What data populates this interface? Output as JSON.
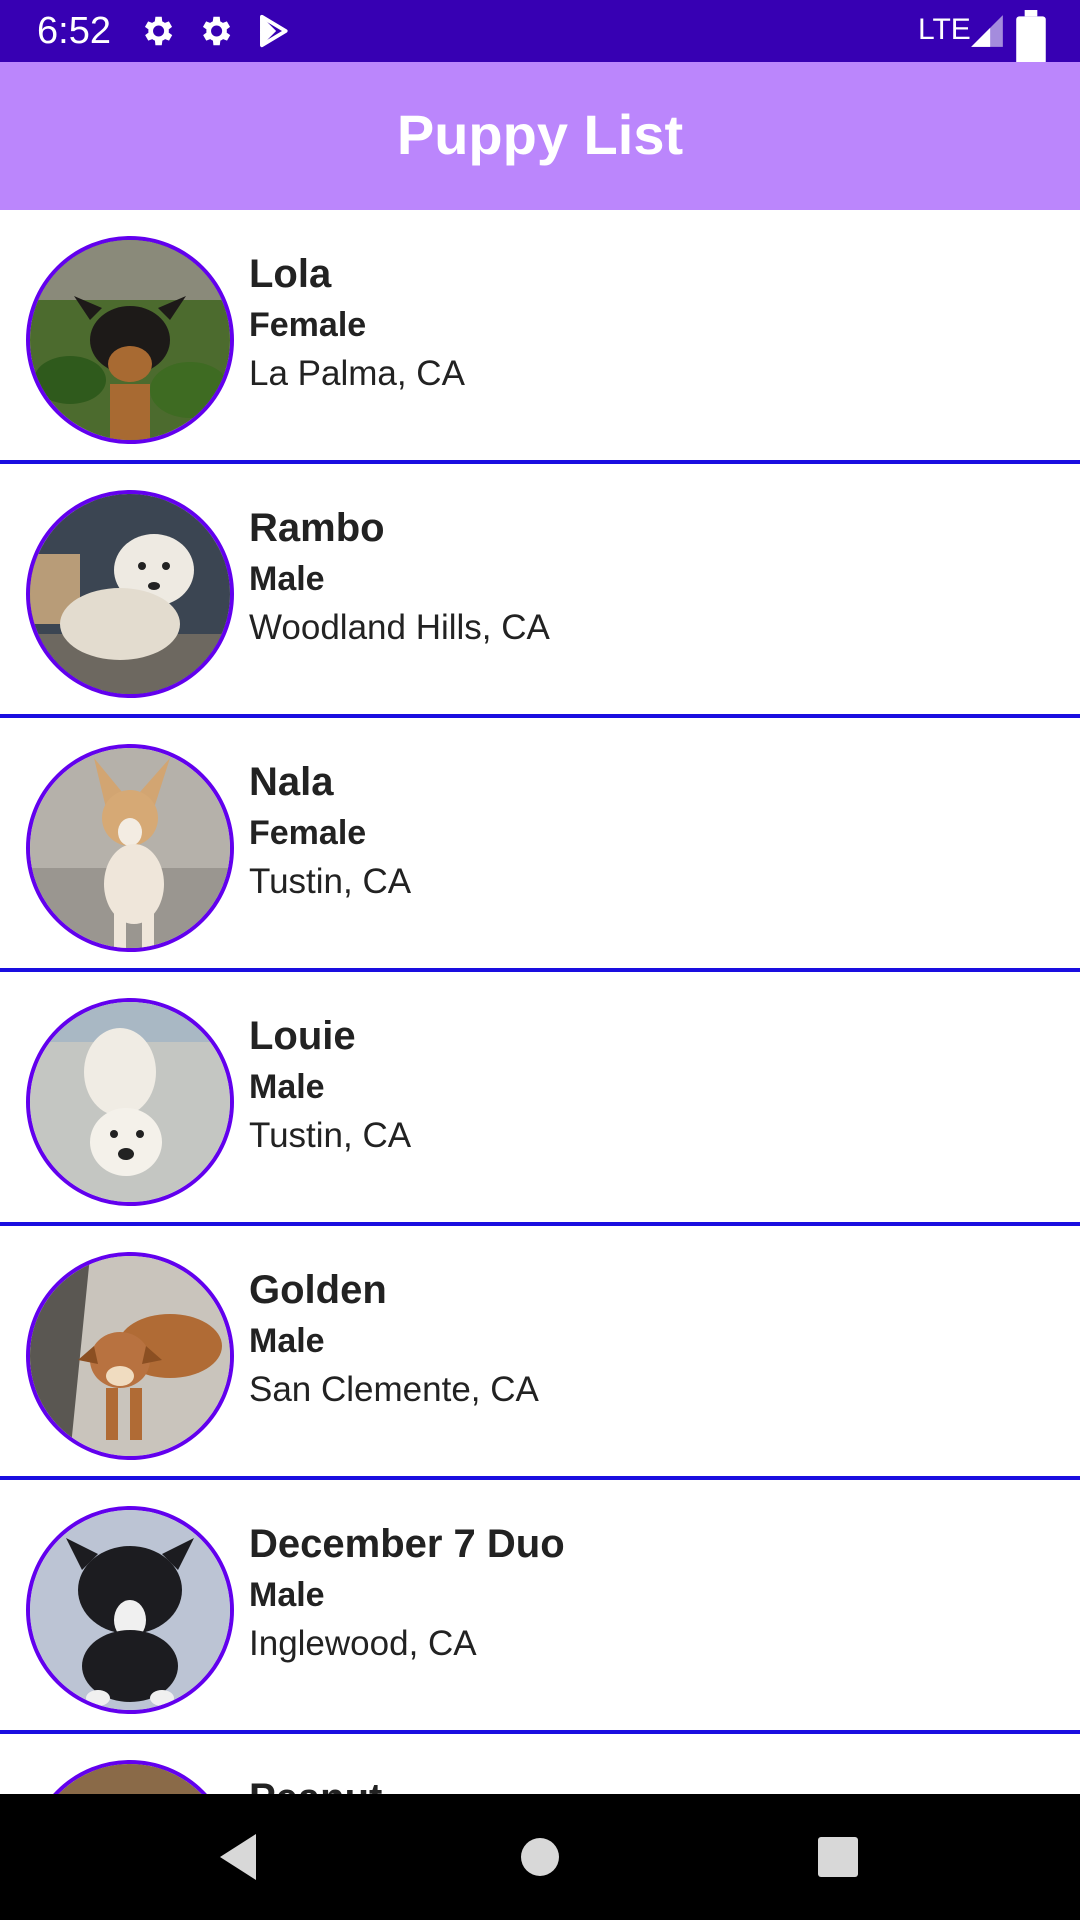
{
  "status_bar": {
    "time": "6:52",
    "network": "LTE",
    "icons": [
      "gear-icon",
      "gear-icon",
      "play-store-icon",
      "signal-icon",
      "battery-icon"
    ]
  },
  "app_bar": {
    "title": "Puppy List"
  },
  "theme": {
    "status_bar": "#3700b3",
    "app_bar": "#bb86fc",
    "avatar_border": "#6200ee",
    "divider": "#1a0ee0"
  },
  "puppies": [
    {
      "name": "Lola",
      "sex": "Female",
      "location": "La Palma, CA"
    },
    {
      "name": "Rambo",
      "sex": "Male",
      "location": "Woodland Hills, CA"
    },
    {
      "name": "Nala",
      "sex": "Female",
      "location": "Tustin, CA"
    },
    {
      "name": "Louie",
      "sex": "Male",
      "location": "Tustin, CA"
    },
    {
      "name": "Golden",
      "sex": "Male",
      "location": "San Clemente, CA"
    },
    {
      "name": "December 7 Duo",
      "sex": "Male",
      "location": "Inglewood, CA"
    },
    {
      "name": "Peanut",
      "sex": "",
      "location": ""
    }
  ],
  "nav_bar": {
    "icons": [
      "back-icon",
      "home-icon",
      "recents-icon"
    ]
  }
}
